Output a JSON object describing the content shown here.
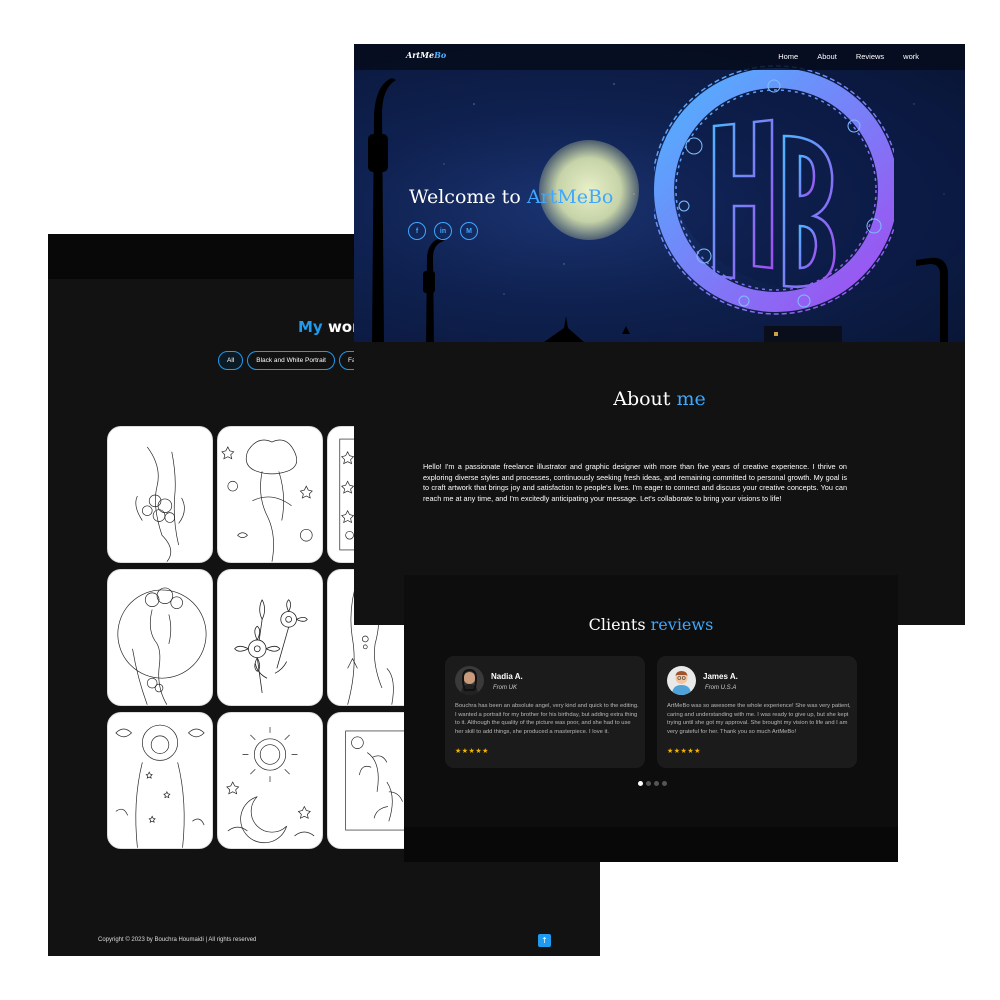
{
  "work": {
    "title_accent": "My",
    "title_rest": "work",
    "filters": [
      "All",
      "Black and White Portrait",
      "Face"
    ],
    "active_filter": "All",
    "gallery_count": 9,
    "copyright": "Copyright © 2023 by Bouchra Houmaidi | All rights reserved",
    "to_top_icon": "arrow-up-icon"
  },
  "home": {
    "logo_white": "ArtMe",
    "logo_blue": "Bo",
    "nav": [
      "Home",
      "About",
      "Reviews",
      "work"
    ],
    "welcome_prefix": "Welcome to",
    "welcome_brand": "ArtMeBo",
    "socials": [
      {
        "icon": "facebook-icon",
        "glyph": "f"
      },
      {
        "icon": "linkedin-icon",
        "glyph": "in"
      },
      {
        "icon": "medium-icon",
        "glyph": "M"
      }
    ]
  },
  "about": {
    "title_white": "About",
    "title_blue": "me",
    "text": "Hello! I'm a passionate freelance illustrator and graphic designer with more than five years of creative experience. I thrive on exploring diverse styles and processes, continuously seeking fresh ideas, and remaining committed to personal growth. My goal is to craft artwork that brings joy and satisfaction to people's lives. I'm eager to connect and discuss your creative concepts. You can reach me at any time, and I'm excitedly anticipating your message. Let's collaborate to bring your visions to life!"
  },
  "reviews": {
    "title_white": "Clients",
    "title_blue": "reviews",
    "items": [
      {
        "name": "Nadia A.",
        "from": "From UK",
        "text": "Bouchra has been an absolute angel, very kind and quick to the editing. I wanted a portrait for my brother for his birthday, but adding extra thing to it. Although the quality of the picture was poor, and she had to use her skill to add things, she produced a masterpiece. I love it.",
        "stars": "★★★★★"
      },
      {
        "name": "James A.",
        "from": "From U.S.A",
        "text": "ArtMeBo was so awesome the whole experience! She was very patient, caring and understanding with me. I was ready to give up, but she kept trying until she got my approval. She brought my vision to life and I am very grateful for her. Thank you so much ArtMeBo!",
        "stars": "★★★★★"
      }
    ],
    "slide_count": 4,
    "active_slide": 1
  },
  "colors": {
    "accent": "#1e9bf0",
    "background": "#121212",
    "star": "#f5b400"
  }
}
